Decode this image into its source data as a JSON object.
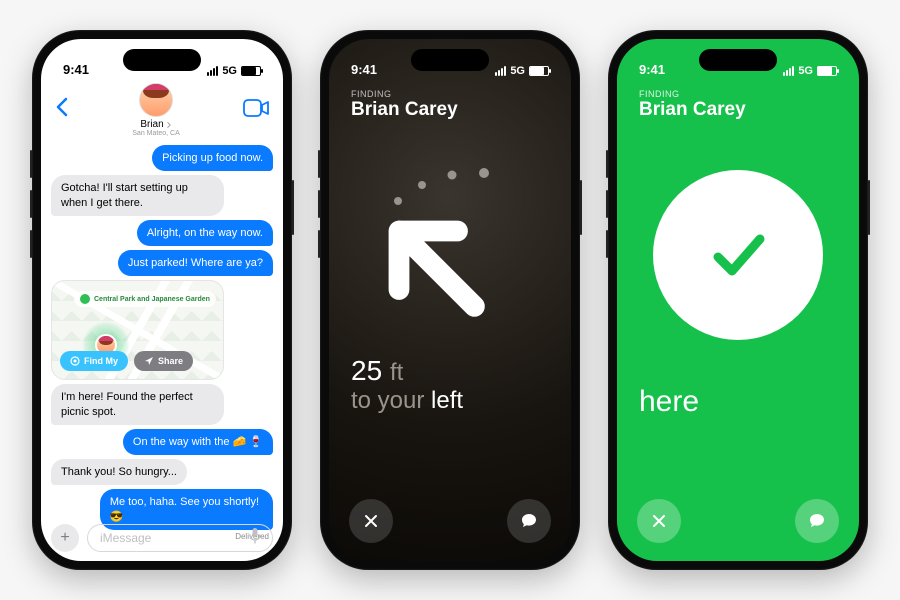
{
  "status": {
    "time": "9:41",
    "network": "5G"
  },
  "phone1": {
    "contact_name": "Brian",
    "contact_sub": "San Mateo, CA",
    "messages": [
      {
        "side": "sent",
        "text": "Picking up food now."
      },
      {
        "side": "recv",
        "text": "Gotcha! I'll start setting up when I get there."
      },
      {
        "side": "sent",
        "text": "Alright, on the way now."
      },
      {
        "side": "sent",
        "text": "Just parked! Where are ya?"
      }
    ],
    "map": {
      "place_label": "Central Park and Japanese Garden",
      "findmy_label": "Find My",
      "share_label": "Share"
    },
    "messages_after": [
      {
        "side": "recv",
        "text": "I'm here! Found the perfect picnic spot."
      },
      {
        "side": "sent",
        "text": "On the way with the 🧀 🍷"
      },
      {
        "side": "recv",
        "text": "Thank you! So hungry..."
      },
      {
        "side": "sent",
        "text": "Me too, haha. See you shortly! 😎"
      }
    ],
    "delivered_label": "Delivered",
    "composer_placeholder": "iMessage"
  },
  "phone2": {
    "finding_label": "FINDING",
    "name": "Brian Carey",
    "distance_value": "25",
    "distance_unit": "ft",
    "line2_prefix": "to your",
    "line2_direction": "left"
  },
  "phone3": {
    "finding_label": "FINDING",
    "name": "Brian Carey",
    "here_label": "here"
  }
}
